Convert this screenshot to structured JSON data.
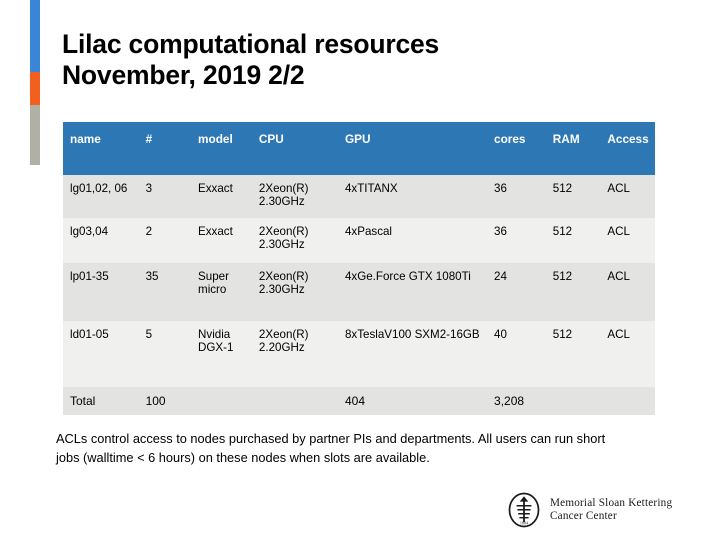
{
  "slide": {
    "title_line1": "Lilac computational resources",
    "title_line2": "November, 2019 2/2",
    "accent_colors": {
      "blue": "#3a85d8",
      "orange": "#f1601e",
      "gray": "#b0b0a4"
    },
    "header_color": "#2e77b5",
    "row_colors": {
      "dark": "#e3e3e1",
      "light": "#f0f0ee"
    }
  },
  "table": {
    "headers": [
      "name",
      "#",
      "model",
      "CPU",
      "GPU",
      "cores",
      "RAM",
      "Access"
    ],
    "rows": [
      {
        "name": "lg01,02, 06",
        "count": "3",
        "model": "Exxact",
        "cpu": "2Xeon(R) 2.30GHz",
        "gpu": "4xTITANX",
        "cores": "36",
        "ram": "512",
        "access": "ACL"
      },
      {
        "name": "lg03,04",
        "count": "2",
        "model": "Exxact",
        "cpu": "2Xeon(R) 2.30GHz",
        "gpu": "4xPascal",
        "cores": "36",
        "ram": "512",
        "access": "ACL"
      },
      {
        "name": "lp01-35",
        "count": "35",
        "model": "Super micro",
        "cpu": "2Xeon(R) 2.30GHz",
        "gpu": "4xGe.Force GTX 1080Ti",
        "cores": "24",
        "ram": "512",
        "access": "ACL"
      },
      {
        "name": "ld01-05",
        "count": "5",
        "model": "Nvidia DGX-1",
        "cpu": "2Xeon(R) 2.20GHz",
        "gpu": "8xTeslaV100 SXM2-16GB",
        "cores": "40",
        "ram": "512",
        "access": "ACL"
      }
    ],
    "total_row": {
      "name": "Total",
      "count": "100",
      "model": "",
      "cpu": "",
      "gpu": "404",
      "cores": "3,208",
      "ram": "",
      "access": ""
    }
  },
  "footer": {
    "note": "ACLs control access to nodes purchased by partner PIs and departments. All users can run short jobs (walltime < 6 hours) on these nodes when slots are available."
  },
  "logo": {
    "seal_text": "1884",
    "name_line1": "Memorial Sloan Kettering",
    "name_line2": "Cancer Center"
  }
}
